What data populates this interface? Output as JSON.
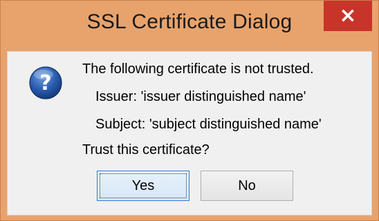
{
  "window": {
    "title": "SSL Certificate Dialog",
    "close_label": "×"
  },
  "message": {
    "icon": "question-icon",
    "heading": "The following certificate is not trusted.",
    "issuer": "Issuer: 'issuer distinguished name'",
    "subject": "Subject: 'subject distinguished name'",
    "question": "Trust this certificate?"
  },
  "buttons": {
    "yes_label": "Yes",
    "no_label": "No"
  },
  "colors": {
    "title_bar": "#e8a36c",
    "close_button": "#c7342a",
    "dialog_background": "#f0f0f0",
    "default_button_border": "#2f7bd4"
  }
}
